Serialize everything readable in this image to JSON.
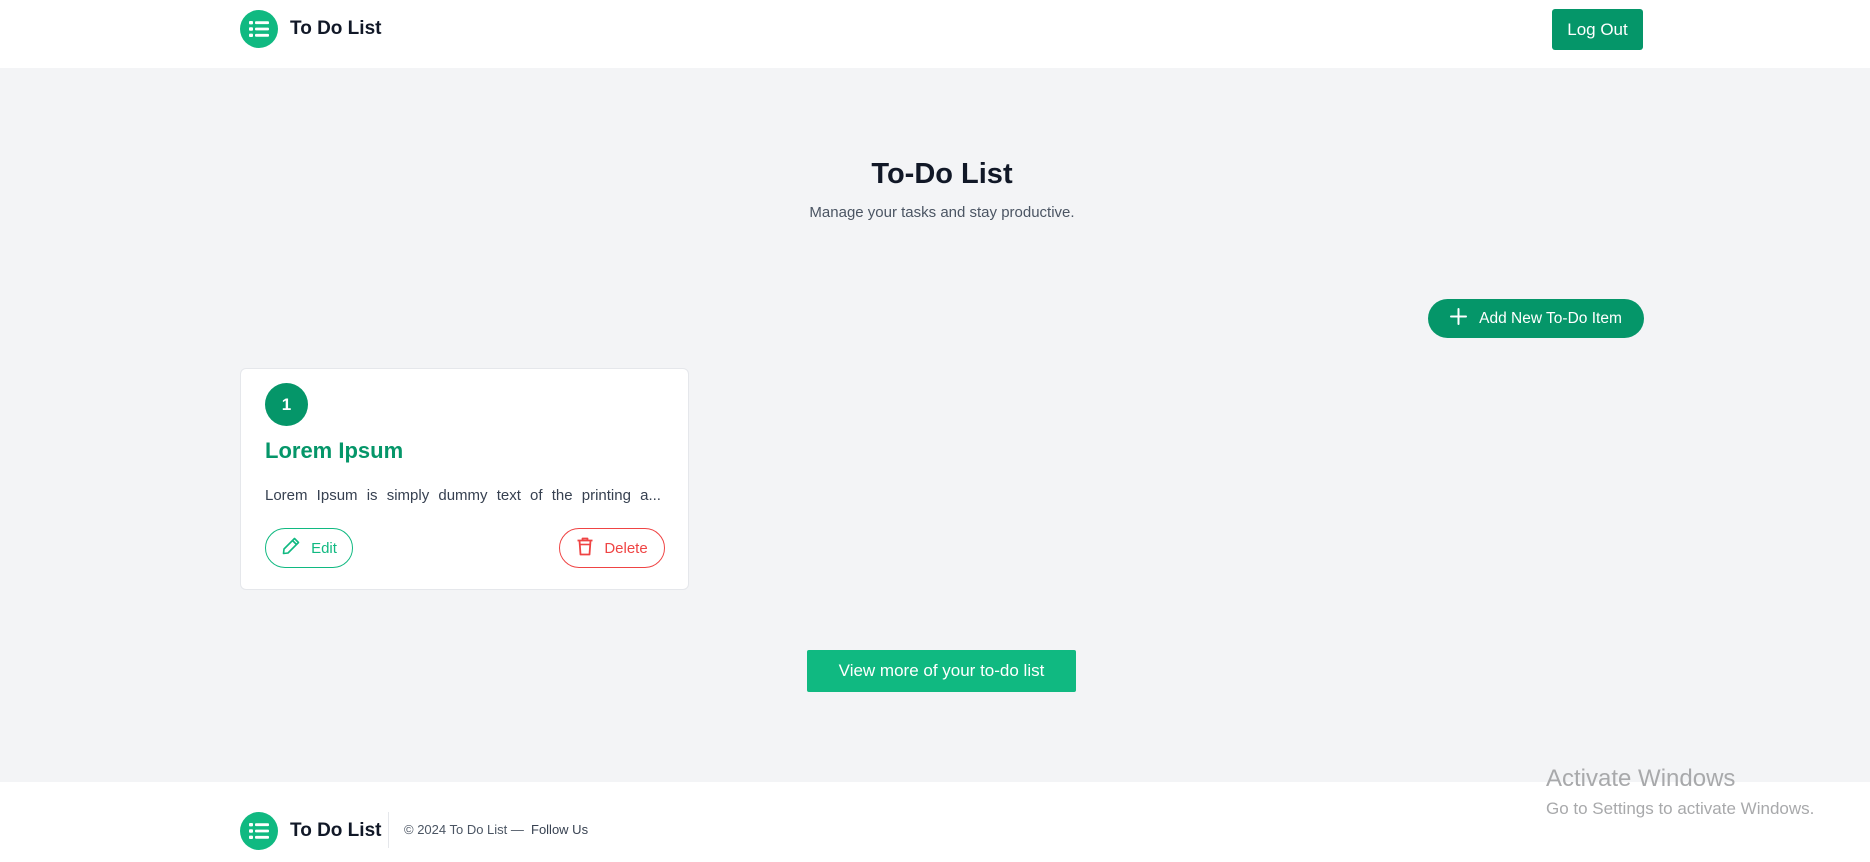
{
  "header": {
    "brand_name": "To Do List",
    "logout_label": "Log Out"
  },
  "hero": {
    "title": "To-Do List",
    "subtitle": "Manage your tasks and stay productive."
  },
  "actions": {
    "add_label": "Add New To-Do Item",
    "view_more_label": "View more of your to-do list"
  },
  "todos": [
    {
      "number": "1",
      "title": "Lorem Ipsum",
      "description": "Lorem Ipsum is simply dummy text of the printing a...",
      "edit_label": "Edit",
      "delete_label": "Delete"
    }
  ],
  "footer": {
    "brand_name": "To Do List",
    "copyright": "© 2024 To Do List —",
    "follow_label": "Follow Us"
  },
  "watermark": {
    "title": "Activate Windows",
    "subtitle": "Go to Settings to activate Windows."
  },
  "colors": {
    "primary": "#059669",
    "accent": "#10b981",
    "danger": "#ef4444",
    "background": "#f3f4f6"
  },
  "icons": {
    "brand": "list-icon",
    "add": "plus-icon",
    "edit": "pencil-icon",
    "delete": "trash-icon"
  }
}
